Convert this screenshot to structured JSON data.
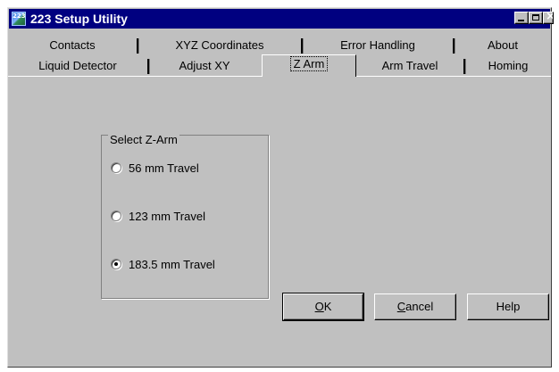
{
  "window": {
    "title": "223 Setup Utility",
    "icon_text": "223",
    "controls": {
      "minimize_icon": "minimize-icon",
      "maximize_icon": "maximize-icon",
      "close_icon": "close-icon"
    }
  },
  "tabs": {
    "back_row": [
      "Contacts",
      "XYZ Coordinates",
      "Error Handling",
      "About"
    ],
    "front_row": [
      "Liquid Detector",
      "Adjust XY",
      "Z Arm",
      "Arm Travel",
      "Homing"
    ],
    "active": "Z Arm"
  },
  "group": {
    "label": "Select Z-Arm",
    "options": [
      {
        "label": "56 mm Travel",
        "checked": false
      },
      {
        "label": "123 mm Travel",
        "checked": false
      },
      {
        "label": "183.5 mm Travel",
        "checked": true
      }
    ]
  },
  "buttons": {
    "ok_mnemonic": "O",
    "ok_rest": "K",
    "cancel_mnemonic": "C",
    "cancel_rest": "ancel",
    "help": "Help"
  },
  "colors": {
    "titlebar": "#000080",
    "face": "#c0c0c0"
  }
}
